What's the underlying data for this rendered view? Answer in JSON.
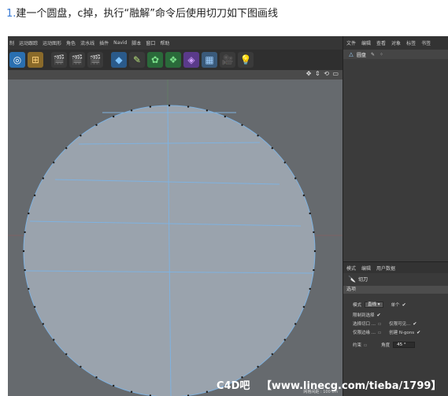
{
  "instruction": {
    "step": "1.",
    "text": "建一个圆盘，c掉，执行“融解”命令后使用切刀如下图画线"
  },
  "menubar": {
    "items": [
      "制",
      "运动跟踪",
      "运动图形",
      "角色",
      "流水线",
      "插件",
      "Navid",
      "脚本",
      "窗口",
      "帮助"
    ]
  },
  "toolbar": {
    "icons": [
      {
        "name": "undo-icon",
        "glyph": "◎",
        "bg": "#2a6fb0",
        "color": "#ffffff"
      },
      {
        "name": "coordinate-icon",
        "glyph": "⊞",
        "bg": "#8a6a2a",
        "color": "#ffd27a"
      },
      {
        "name": "render-view-icon",
        "glyph": "🎬",
        "bg": "#3a3a3a",
        "color": "#ffffff"
      },
      {
        "name": "render-region-icon",
        "glyph": "🎬",
        "bg": "#3a3a3a",
        "color": "#ffffff"
      },
      {
        "name": "render-settings-icon",
        "glyph": "🎬",
        "bg": "#3a3a3a",
        "color": "#ffffff"
      },
      {
        "name": "cube-icon",
        "glyph": "◆",
        "bg": "#2a5a8a",
        "color": "#7fc4ff"
      },
      {
        "name": "pen-icon",
        "glyph": "✎",
        "bg": "#3a3a3a",
        "color": "#b5e07a"
      },
      {
        "name": "subdivision-icon",
        "glyph": "✿",
        "bg": "#2a6a3a",
        "color": "#7ae08a"
      },
      {
        "name": "array-icon",
        "glyph": "❖",
        "bg": "#2a6a3a",
        "color": "#7ae08a"
      },
      {
        "name": "deformer-icon",
        "glyph": "◈",
        "bg": "#5a3a8a",
        "color": "#d0a0ff"
      },
      {
        "name": "floor-icon",
        "glyph": "▦",
        "bg": "#3a5a7a",
        "color": "#a0d0ff"
      },
      {
        "name": "camera-icon",
        "glyph": "🎥",
        "bg": "#3a3a3a",
        "color": "#ffffff"
      },
      {
        "name": "light-icon",
        "glyph": "💡",
        "bg": "#3a3a3a",
        "color": "#ffffff"
      }
    ]
  },
  "viewport": {
    "nav_icons": "✥ ⇕ ⟲ ▭",
    "footer": "网格间距 : 100 cm"
  },
  "object_manager": {
    "tabs": [
      "文件",
      "编辑",
      "查看",
      "对象",
      "标签",
      "书签"
    ],
    "object_name": "圆盘",
    "tags": "✎ ⁘"
  },
  "attributes": {
    "tabs": [
      "模式",
      "编辑",
      "用户数据"
    ],
    "tool_name": "切刀",
    "section": "选项",
    "mode_label": "模式",
    "mode_value": "直线",
    "single_label": "单个",
    "restrict_label": "限制到选择",
    "select_cut_label": "选择切口 ...",
    "visible_only_label": "仅限可见...",
    "edges_only_label": "仅限边缘 ...",
    "create_ngons_label": "创建 N-gons",
    "constrain_label": "约束",
    "angle_label": "角度",
    "angle_value": "45 °"
  },
  "watermark": {
    "brand": "C4D吧",
    "url": "【www.linecg.com/tieba/1799】"
  },
  "colors": {
    "viewport_bg": "#666a6e",
    "disk_fill": "#9aa3ad",
    "cut_lines": "#7fb2e0",
    "vertex": "#1b1b1b"
  }
}
